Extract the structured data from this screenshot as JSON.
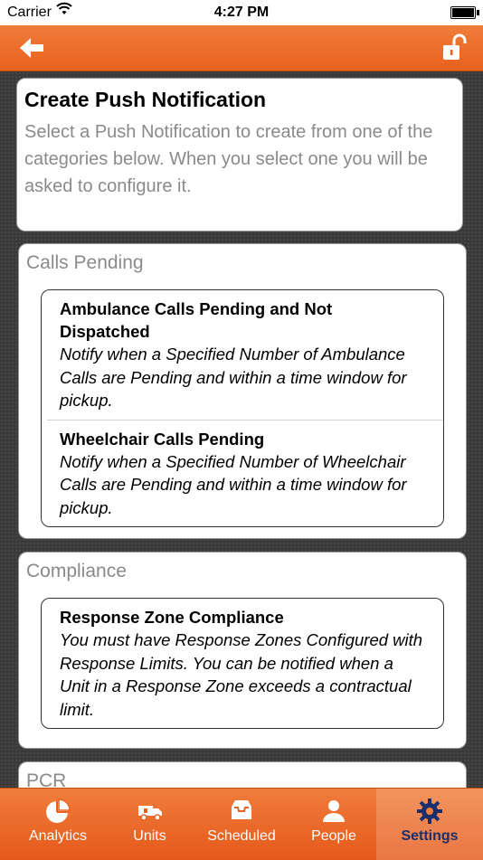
{
  "status_bar": {
    "carrier": "Carrier",
    "time": "4:27 PM"
  },
  "nav": {
    "back_icon": "back-arrow-icon",
    "lock_icon": "unlock-icon"
  },
  "intro": {
    "title": "Create Push Notification",
    "description": "Select a Push Notification to create from one of the categories below. When you select one you will be asked to configure it."
  },
  "sections": [
    {
      "title": "Calls Pending",
      "items": [
        {
          "title": "Ambulance Calls Pending and Not Dispatched",
          "description": "Notify when a Specified Number of Ambulance Calls are Pending and within a time window for pickup."
        },
        {
          "title": "Wheelchair Calls Pending",
          "description": "Notify when a Specified Number of Wheelchair Calls are Pending and within a time window for pickup."
        }
      ]
    },
    {
      "title": "Compliance",
      "items": [
        {
          "title": "Response Zone Compliance",
          "description": "You must have Response Zones Configured with Response Limits. You can be notified when a Unit in a Response Zone exceeds a contractual limit."
        }
      ]
    },
    {
      "title": "PCR",
      "items": []
    }
  ],
  "tabs": [
    {
      "label": "Analytics",
      "icon": "pie-chart-icon",
      "active": false
    },
    {
      "label": "Units",
      "icon": "truck-icon",
      "active": false
    },
    {
      "label": "Scheduled",
      "icon": "inbox-tray-icon",
      "active": false
    },
    {
      "label": "People",
      "icon": "person-icon",
      "active": false
    },
    {
      "label": "Settings",
      "icon": "gear-icon",
      "active": true
    }
  ],
  "colors": {
    "nav_orange": "#e8611d",
    "active_tab_text": "#1a2f6b",
    "subtle_text": "#8a8a8a"
  }
}
